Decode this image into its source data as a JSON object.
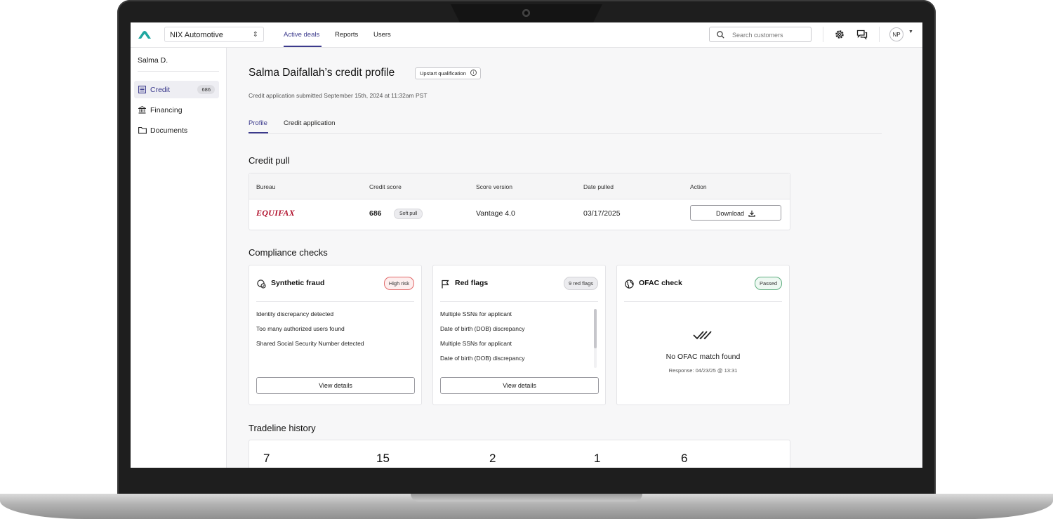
{
  "header": {
    "org_name": "NIX Automotive",
    "nav_tabs": [
      "Active deals",
      "Reports",
      "Users"
    ],
    "search_placeholder": "Search customers",
    "avatar_initials": "NP"
  },
  "sidebar": {
    "customer_name": "Salma D.",
    "items": [
      {
        "label": "Credit",
        "count": "686",
        "icon": "list-icon"
      },
      {
        "label": "Financing",
        "icon": "bank-icon"
      },
      {
        "label": "Documents",
        "icon": "folder-icon"
      }
    ]
  },
  "profile": {
    "title": "Salma Daifallah’s credit profile",
    "qualification_badge": "Upstart qualification",
    "submitted": "Credit application submitted September 15th, 2024 at 11:32am PST",
    "tabs": [
      "Profile",
      "Credit application"
    ]
  },
  "credit_pull": {
    "section_title": "Credit pull",
    "columns": [
      "Bureau",
      "Credit score",
      "Score version",
      "Date pulled",
      "Action"
    ],
    "row": {
      "bureau": "EQUIFAX",
      "score": "686",
      "pull_type": "Soft pull",
      "score_version": "Vantage 4.0",
      "date_pulled": "03/17/2025",
      "action_label": "Download"
    }
  },
  "compliance": {
    "section_title": "Compliance checks",
    "synthetic_fraud": {
      "title": "Synthetic fraud",
      "badge": "High risk",
      "items": [
        "Identity discrepancy detected",
        "Too many authorized users found",
        "Shared Social Security Number detected"
      ],
      "button": "View details"
    },
    "red_flags": {
      "title": "Red flags",
      "badge": "9 red flags",
      "items": [
        "Multiple SSNs for applicant",
        "Date of birth (DOB) discrepancy",
        "Multiple SSNs for applicant",
        "Date of birth (DOB) discrepancy"
      ],
      "button": "View details"
    },
    "ofac": {
      "title": "OFAC check",
      "badge": "Passed",
      "message": "No OFAC match found",
      "response": "Response: 04/23/25 @ 13:31"
    }
  },
  "tradeline": {
    "section_title": "Tradeline history",
    "values": [
      "7",
      "15",
      "2",
      "1",
      "6"
    ]
  },
  "colors": {
    "accent": "#3b3a8c",
    "logo": "#1fa7a0",
    "equifax": "#b0102b",
    "risk": "#e26a6a",
    "pass": "#5fae80"
  }
}
